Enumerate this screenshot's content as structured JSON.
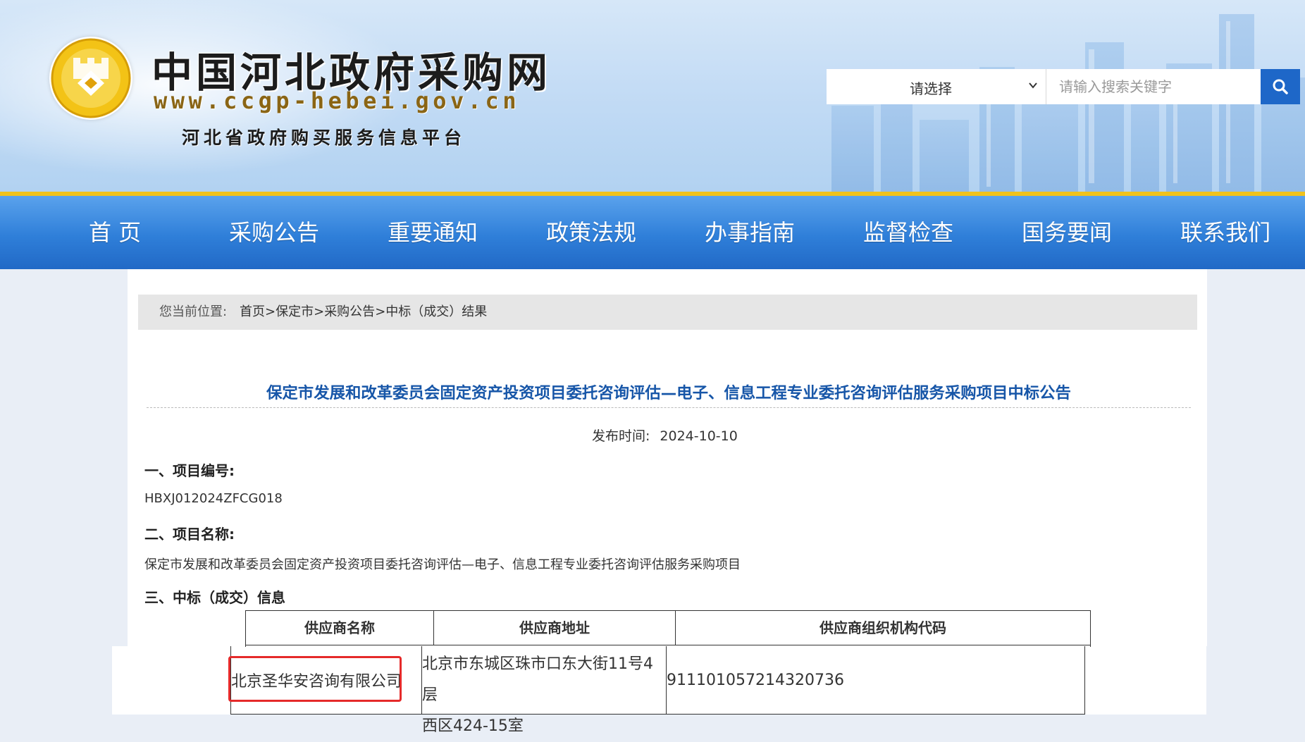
{
  "header": {
    "site_title": "中国河北政府采购网",
    "site_url": "www.ccgp-hebei.gov.cn",
    "site_subtitle": "河北省政府购买服务信息平台",
    "search": {
      "select_value": "请选择",
      "input_placeholder": "请输入搜索关键字"
    }
  },
  "nav": {
    "items": [
      "首 页",
      "采购公告",
      "重要通知",
      "政策法规",
      "办事指南",
      "监督检查",
      "国务要闻",
      "联系我们"
    ]
  },
  "breadcrumb": {
    "prefix": "您当前位置:",
    "links": [
      "首页",
      "保定市",
      "采购公告"
    ],
    "separator": ">",
    "current": "中标（成交）结果"
  },
  "notice": {
    "title": "保定市发展和改革委员会固定资产投资项目委托咨询评估—电子、信息工程专业委托咨询评估服务采购项目中标公告",
    "publish_label": "发布时间:",
    "publish_date": "2024-10-10",
    "sections": {
      "project_no_heading": "一、项目编号:",
      "project_no_value": "HBXJ012024ZFCG018",
      "project_name_heading": "二、项目名称:",
      "project_name_value": "保定市发展和改革委员会固定资产投资项目委托咨询评估—电子、信息工程专业委托咨询评估服务采购项目",
      "award_heading": "三、中标（成交）信息"
    },
    "table": {
      "headers": [
        "供应商名称",
        "供应商地址",
        "供应商组织机构代码"
      ],
      "row": {
        "name": "北京圣华安咨询有限公司",
        "address_line1": "北京市东城区珠市口东大街11号4层",
        "address_line2": "西区424-15室",
        "code": "911101057214320736"
      }
    }
  },
  "colors": {
    "nav_blue": "#2f7fd9",
    "nav_accent": "#f0c21c",
    "title_blue": "#1756a8",
    "search_button": "#1e67c8",
    "highlight_red": "#e52a2a"
  },
  "icons": {
    "logo": "coin-emblem-icon",
    "dropdown": "chevron-down-icon",
    "search": "search-icon"
  }
}
